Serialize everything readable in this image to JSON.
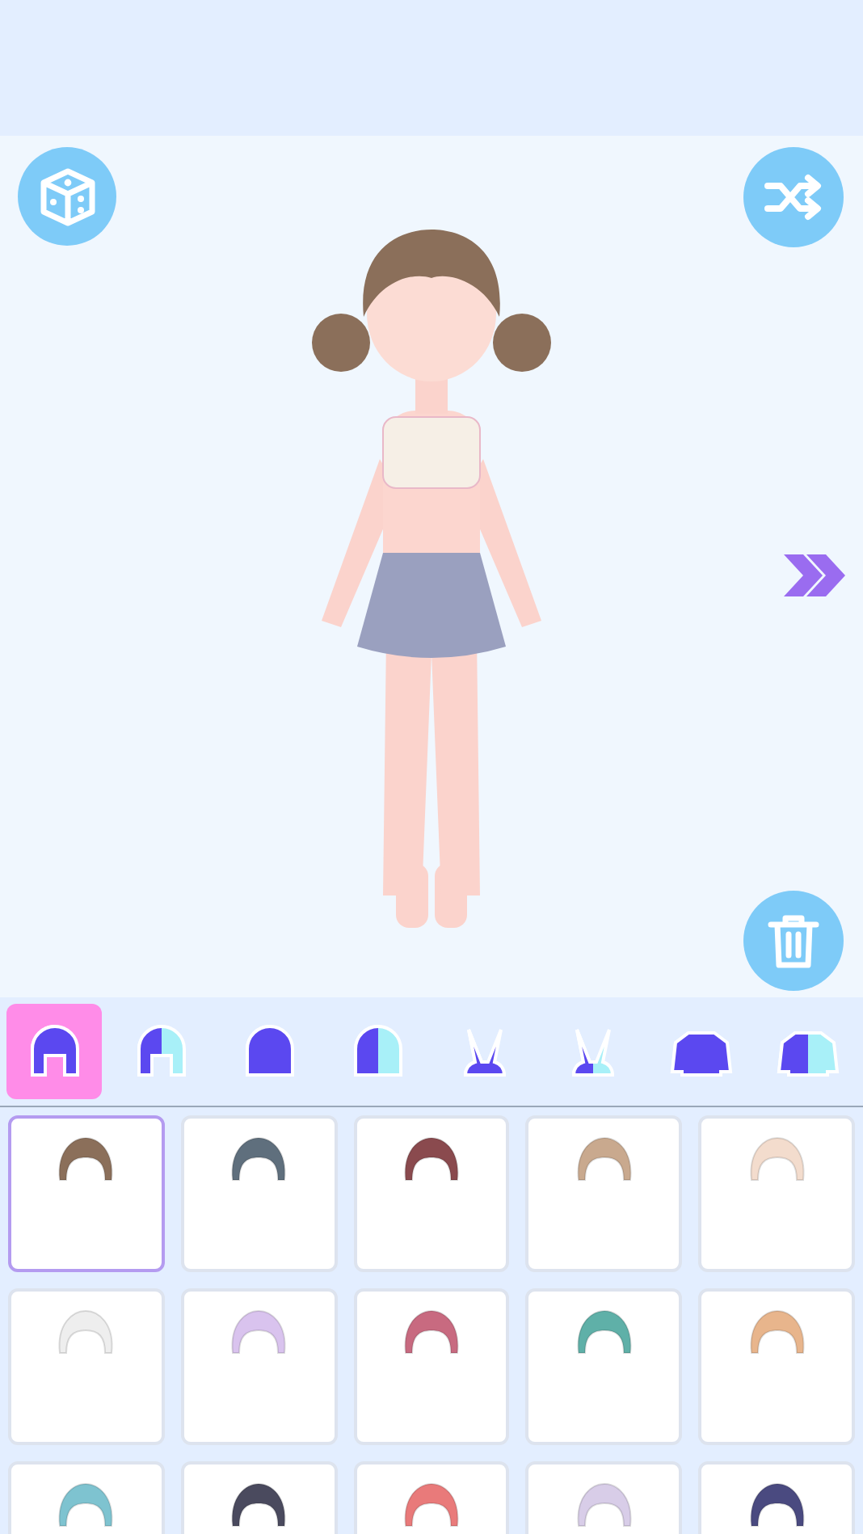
{
  "categories": [
    {
      "kind": "hair",
      "split": false,
      "selected": true
    },
    {
      "kind": "hair",
      "split": true,
      "selected": false
    },
    {
      "kind": "bangs",
      "split": false,
      "selected": false
    },
    {
      "kind": "bangs",
      "split": true,
      "selected": false
    },
    {
      "kind": "ears",
      "split": false,
      "selected": false
    },
    {
      "kind": "ears",
      "split": true,
      "selected": false
    },
    {
      "kind": "top",
      "split": false,
      "selected": false
    },
    {
      "kind": "top",
      "split": true,
      "selected": false
    }
  ],
  "items": [
    {
      "color": "#8b6f5a",
      "selected": true
    },
    {
      "color": "#5f6f7d",
      "selected": false
    },
    {
      "color": "#8a4a4e",
      "selected": false
    },
    {
      "color": "#c9a98e",
      "selected": false
    },
    {
      "color": "#f3dccd",
      "selected": false
    },
    {
      "color": "#eeeeee",
      "selected": false
    },
    {
      "color": "#d9c3ee",
      "selected": false
    },
    {
      "color": "#c86a80",
      "selected": false
    },
    {
      "color": "#5fb0a8",
      "selected": false
    },
    {
      "color": "#e8b58c",
      "selected": false
    },
    {
      "color": "#7ec3d0",
      "selected": false
    },
    {
      "color": "#4a4a5e",
      "selected": false
    },
    {
      "color": "#e97a7a",
      "selected": false
    },
    {
      "color": "#d8cde8",
      "selected": false
    },
    {
      "color": "#4a4a80",
      "selected": false
    }
  ]
}
